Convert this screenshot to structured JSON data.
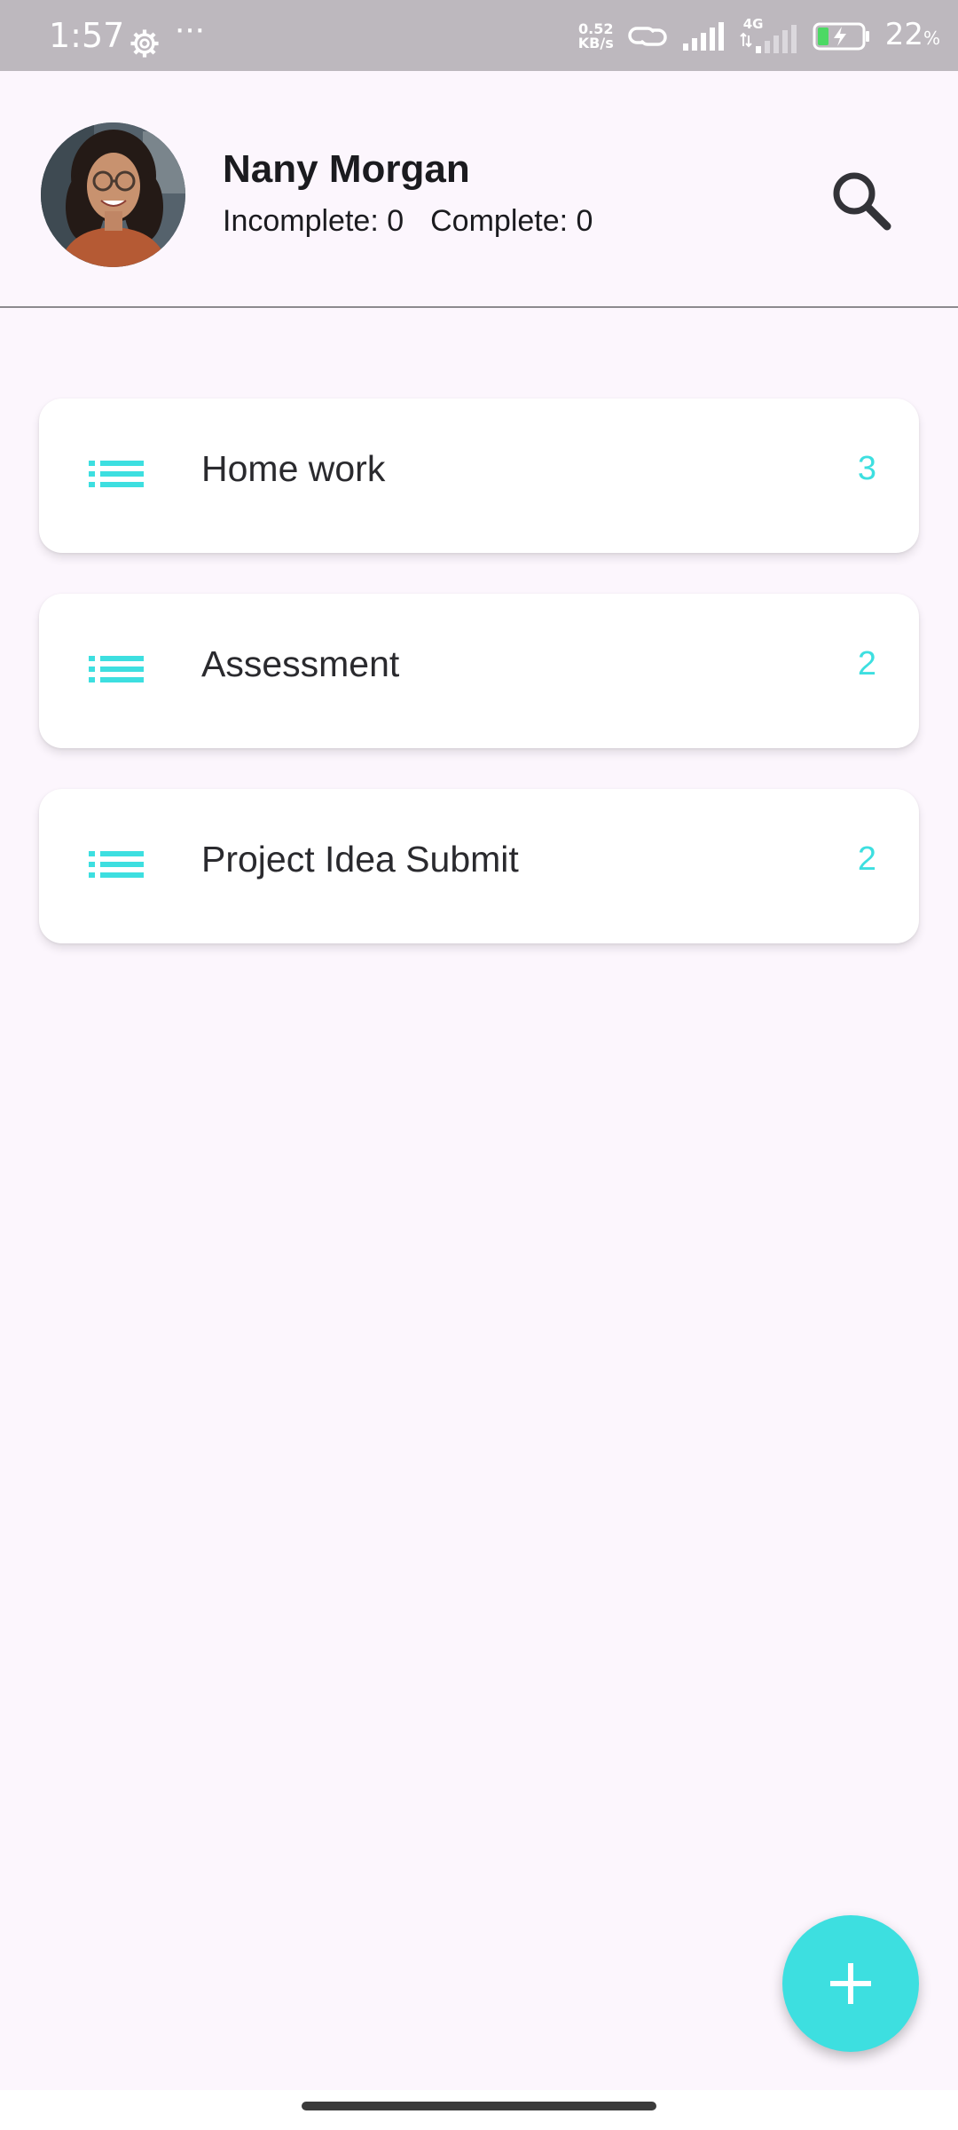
{
  "status_bar": {
    "time": "1:57",
    "more_dots": "···",
    "net_speed_value": "0.52",
    "net_speed_unit": "KB/s",
    "network_type": "4G",
    "battery_percent": "22",
    "battery_unit": "%"
  },
  "profile": {
    "name": "Nany Morgan",
    "incomplete_label": "Incomplete: 0",
    "complete_label": "Complete: 0"
  },
  "lists": [
    {
      "title": "Home work",
      "count": "3"
    },
    {
      "title": "Assessment",
      "count": "2"
    },
    {
      "title": "Project Idea Submit",
      "count": "2"
    }
  ],
  "colors": {
    "accent": "#3ddfe0",
    "background": "#fcf6fd",
    "status_bar": "#bdb8be",
    "card": "#ffffff"
  },
  "icons": {
    "search": "search-icon",
    "list": "list-icon",
    "add": "plus-icon",
    "settings": "gear-icon"
  }
}
